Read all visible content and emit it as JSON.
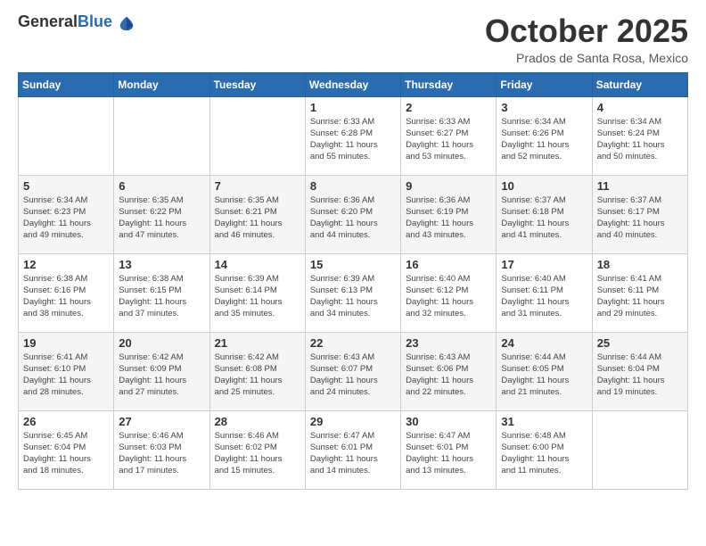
{
  "logo": {
    "general": "General",
    "blue": "Blue"
  },
  "header": {
    "month": "October 2025",
    "location": "Prados de Santa Rosa, Mexico"
  },
  "weekdays": [
    "Sunday",
    "Monday",
    "Tuesday",
    "Wednesday",
    "Thursday",
    "Friday",
    "Saturday"
  ],
  "weeks": [
    [
      {
        "day": "",
        "info": ""
      },
      {
        "day": "",
        "info": ""
      },
      {
        "day": "",
        "info": ""
      },
      {
        "day": "1",
        "info": "Sunrise: 6:33 AM\nSunset: 6:28 PM\nDaylight: 11 hours\nand 55 minutes."
      },
      {
        "day": "2",
        "info": "Sunrise: 6:33 AM\nSunset: 6:27 PM\nDaylight: 11 hours\nand 53 minutes."
      },
      {
        "day": "3",
        "info": "Sunrise: 6:34 AM\nSunset: 6:26 PM\nDaylight: 11 hours\nand 52 minutes."
      },
      {
        "day": "4",
        "info": "Sunrise: 6:34 AM\nSunset: 6:24 PM\nDaylight: 11 hours\nand 50 minutes."
      }
    ],
    [
      {
        "day": "5",
        "info": "Sunrise: 6:34 AM\nSunset: 6:23 PM\nDaylight: 11 hours\nand 49 minutes."
      },
      {
        "day": "6",
        "info": "Sunrise: 6:35 AM\nSunset: 6:22 PM\nDaylight: 11 hours\nand 47 minutes."
      },
      {
        "day": "7",
        "info": "Sunrise: 6:35 AM\nSunset: 6:21 PM\nDaylight: 11 hours\nand 46 minutes."
      },
      {
        "day": "8",
        "info": "Sunrise: 6:36 AM\nSunset: 6:20 PM\nDaylight: 11 hours\nand 44 minutes."
      },
      {
        "day": "9",
        "info": "Sunrise: 6:36 AM\nSunset: 6:19 PM\nDaylight: 11 hours\nand 43 minutes."
      },
      {
        "day": "10",
        "info": "Sunrise: 6:37 AM\nSunset: 6:18 PM\nDaylight: 11 hours\nand 41 minutes."
      },
      {
        "day": "11",
        "info": "Sunrise: 6:37 AM\nSunset: 6:17 PM\nDaylight: 11 hours\nand 40 minutes."
      }
    ],
    [
      {
        "day": "12",
        "info": "Sunrise: 6:38 AM\nSunset: 6:16 PM\nDaylight: 11 hours\nand 38 minutes."
      },
      {
        "day": "13",
        "info": "Sunrise: 6:38 AM\nSunset: 6:15 PM\nDaylight: 11 hours\nand 37 minutes."
      },
      {
        "day": "14",
        "info": "Sunrise: 6:39 AM\nSunset: 6:14 PM\nDaylight: 11 hours\nand 35 minutes."
      },
      {
        "day": "15",
        "info": "Sunrise: 6:39 AM\nSunset: 6:13 PM\nDaylight: 11 hours\nand 34 minutes."
      },
      {
        "day": "16",
        "info": "Sunrise: 6:40 AM\nSunset: 6:12 PM\nDaylight: 11 hours\nand 32 minutes."
      },
      {
        "day": "17",
        "info": "Sunrise: 6:40 AM\nSunset: 6:11 PM\nDaylight: 11 hours\nand 31 minutes."
      },
      {
        "day": "18",
        "info": "Sunrise: 6:41 AM\nSunset: 6:11 PM\nDaylight: 11 hours\nand 29 minutes."
      }
    ],
    [
      {
        "day": "19",
        "info": "Sunrise: 6:41 AM\nSunset: 6:10 PM\nDaylight: 11 hours\nand 28 minutes."
      },
      {
        "day": "20",
        "info": "Sunrise: 6:42 AM\nSunset: 6:09 PM\nDaylight: 11 hours\nand 27 minutes."
      },
      {
        "day": "21",
        "info": "Sunrise: 6:42 AM\nSunset: 6:08 PM\nDaylight: 11 hours\nand 25 minutes."
      },
      {
        "day": "22",
        "info": "Sunrise: 6:43 AM\nSunset: 6:07 PM\nDaylight: 11 hours\nand 24 minutes."
      },
      {
        "day": "23",
        "info": "Sunrise: 6:43 AM\nSunset: 6:06 PM\nDaylight: 11 hours\nand 22 minutes."
      },
      {
        "day": "24",
        "info": "Sunrise: 6:44 AM\nSunset: 6:05 PM\nDaylight: 11 hours\nand 21 minutes."
      },
      {
        "day": "25",
        "info": "Sunrise: 6:44 AM\nSunset: 6:04 PM\nDaylight: 11 hours\nand 19 minutes."
      }
    ],
    [
      {
        "day": "26",
        "info": "Sunrise: 6:45 AM\nSunset: 6:04 PM\nDaylight: 11 hours\nand 18 minutes."
      },
      {
        "day": "27",
        "info": "Sunrise: 6:46 AM\nSunset: 6:03 PM\nDaylight: 11 hours\nand 17 minutes."
      },
      {
        "day": "28",
        "info": "Sunrise: 6:46 AM\nSunset: 6:02 PM\nDaylight: 11 hours\nand 15 minutes."
      },
      {
        "day": "29",
        "info": "Sunrise: 6:47 AM\nSunset: 6:01 PM\nDaylight: 11 hours\nand 14 minutes."
      },
      {
        "day": "30",
        "info": "Sunrise: 6:47 AM\nSunset: 6:01 PM\nDaylight: 11 hours\nand 13 minutes."
      },
      {
        "day": "31",
        "info": "Sunrise: 6:48 AM\nSunset: 6:00 PM\nDaylight: 11 hours\nand 11 minutes."
      },
      {
        "day": "",
        "info": ""
      }
    ]
  ]
}
